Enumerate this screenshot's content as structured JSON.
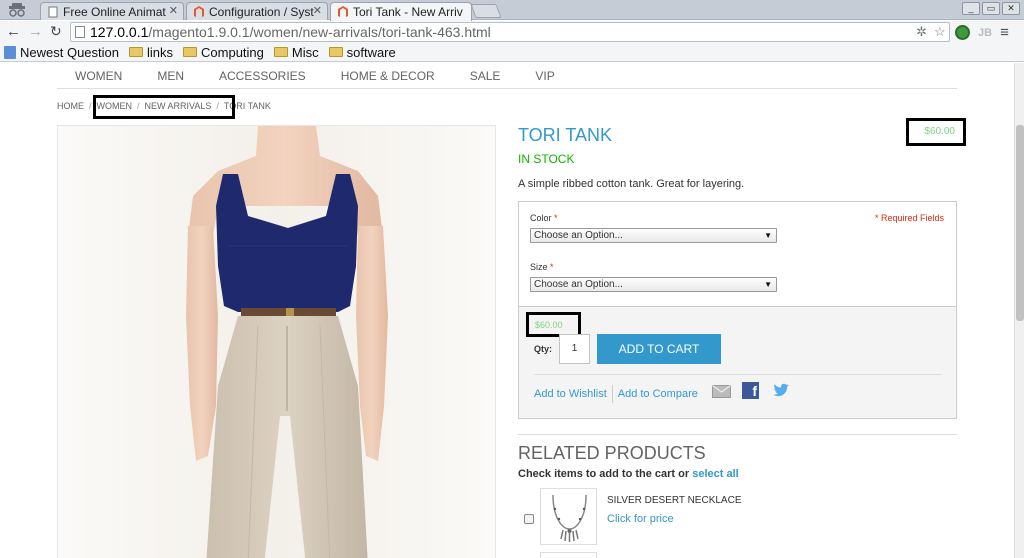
{
  "browser": {
    "tabs": [
      {
        "title": "Free Online Animat",
        "active": false
      },
      {
        "title": "Configuration / Syst",
        "active": false
      },
      {
        "title": "Tori Tank - New Arriv",
        "active": true
      }
    ],
    "url_host": "127.0.0.1",
    "url_path": "/magento1.9.0.1/women/new-arrivals/tori-tank-463.html",
    "extension_label": "JB",
    "window_buttons": [
      "_",
      "▭",
      "✕"
    ]
  },
  "bookmarks": [
    {
      "label": "Newest Question",
      "type": "site"
    },
    {
      "label": "links",
      "type": "folder"
    },
    {
      "label": "Computing",
      "type": "folder"
    },
    {
      "label": "Misc",
      "type": "folder"
    },
    {
      "label": "software",
      "type": "folder"
    }
  ],
  "nav": [
    "Women",
    "Men",
    "Accessories",
    "Home & Decor",
    "Sale",
    "VIP"
  ],
  "breadcrumb": [
    "Home",
    "Women",
    "New Arrivals",
    "Tori Tank"
  ],
  "product": {
    "name": "TORI TANK",
    "price": "$60.00",
    "stock": "In stock",
    "description": "A simple ribbed cotton tank. Great for layering.",
    "required_note": "* Required Fields",
    "options": [
      {
        "label": "Color",
        "required_mark": "*",
        "selected": "Choose an Option..."
      },
      {
        "label": "Size",
        "required_mark": "*",
        "selected": "Choose an Option..."
      }
    ],
    "qty_label": "Qty:",
    "qty_value": "1",
    "add_to_cart": "Add to Cart",
    "wishlist": "Add to Wishlist",
    "compare": "Add to Compare"
  },
  "related": {
    "title": "Related Products",
    "check_text": "Check items to add to the cart or",
    "select_all": "select all",
    "items": [
      {
        "name": "Silver Desert Necklace",
        "price": "Click for price"
      }
    ]
  },
  "colors": {
    "accent": "#3399cc",
    "in_stock": "#11b400",
    "price_highlight": "#7fd57f",
    "required": "#df280a",
    "facebook": "#3b5998",
    "twitter": "#55acee"
  }
}
